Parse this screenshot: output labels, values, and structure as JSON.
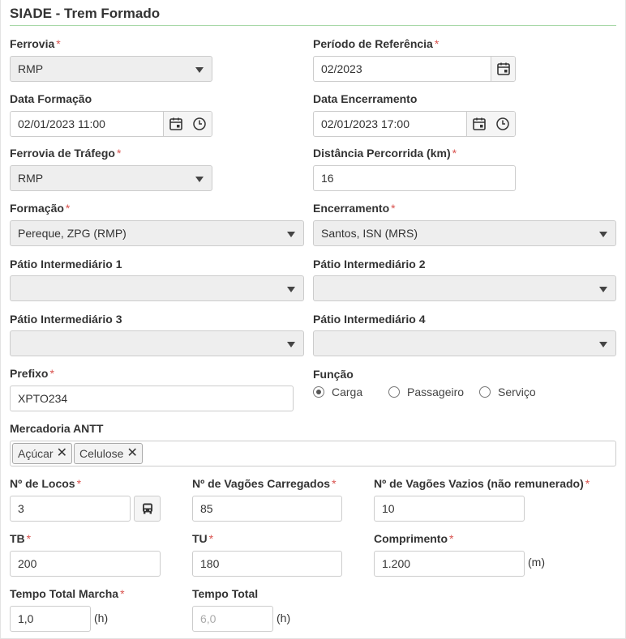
{
  "title": "SIADE - Trem Formado",
  "required_mark": "*",
  "ferrovia": {
    "label": "Ferrovia",
    "value": "RMP"
  },
  "periodo": {
    "label": "Período de Referência",
    "value": "02/2023"
  },
  "data_formacao": {
    "label": "Data Formação",
    "value": "02/01/2023 11:00"
  },
  "data_encerramento": {
    "label": "Data Encerramento",
    "value": "02/01/2023 17:00"
  },
  "ferrovia_trafego": {
    "label": "Ferrovia de Tráfego",
    "value": "RMP"
  },
  "distancia": {
    "label": "Distância Percorrida (km)",
    "value": "16"
  },
  "formacao": {
    "label": "Formação",
    "value": "Pereque, ZPG (RMP)"
  },
  "encerramento": {
    "label": "Encerramento",
    "value": "Santos, ISN (MRS)"
  },
  "patio1": {
    "label": "Pátio Intermediário 1",
    "value": ""
  },
  "patio2": {
    "label": "Pátio Intermediário 2",
    "value": ""
  },
  "patio3": {
    "label": "Pátio Intermediário 3",
    "value": ""
  },
  "patio4": {
    "label": "Pátio Intermediário 4",
    "value": ""
  },
  "prefixo": {
    "label": "Prefixo",
    "value": "XPTO234"
  },
  "funcao": {
    "label": "Função",
    "selected": "Carga",
    "options": [
      "Carga",
      "Passageiro",
      "Serviço"
    ]
  },
  "mercadoria": {
    "label": "Mercadoria ANTT",
    "tags": [
      "Açúcar",
      "Celulose"
    ]
  },
  "locos": {
    "label": "Nº de Locos",
    "value": "3"
  },
  "vagoes_carregados": {
    "label": "Nº de Vagões Carregados",
    "value": "85"
  },
  "vagoes_vazios": {
    "label": "Nº de Vagões Vazios (não remunerado)",
    "value": "10"
  },
  "tb": {
    "label": "TB",
    "value": "200"
  },
  "tu": {
    "label": "TU",
    "value": "180"
  },
  "comprimento": {
    "label": "Comprimento",
    "value": "1.200",
    "unit": "(m)"
  },
  "tempo_marcha": {
    "label": "Tempo Total Marcha",
    "value": "1,0",
    "unit": "(h)"
  },
  "tempo_total": {
    "label": "Tempo Total",
    "value": "6,0",
    "unit": "(h)"
  },
  "icons": {
    "calendar": "calendar-icon",
    "clock": "clock-icon",
    "bus": "bus-icon",
    "remove": "remove-tag-icon",
    "dropdown": "chevron-down-icon"
  },
  "colors": {
    "required": "#d9534f",
    "title_rule": "#a8d8a8",
    "readonly_bg": "#eeeeee"
  }
}
